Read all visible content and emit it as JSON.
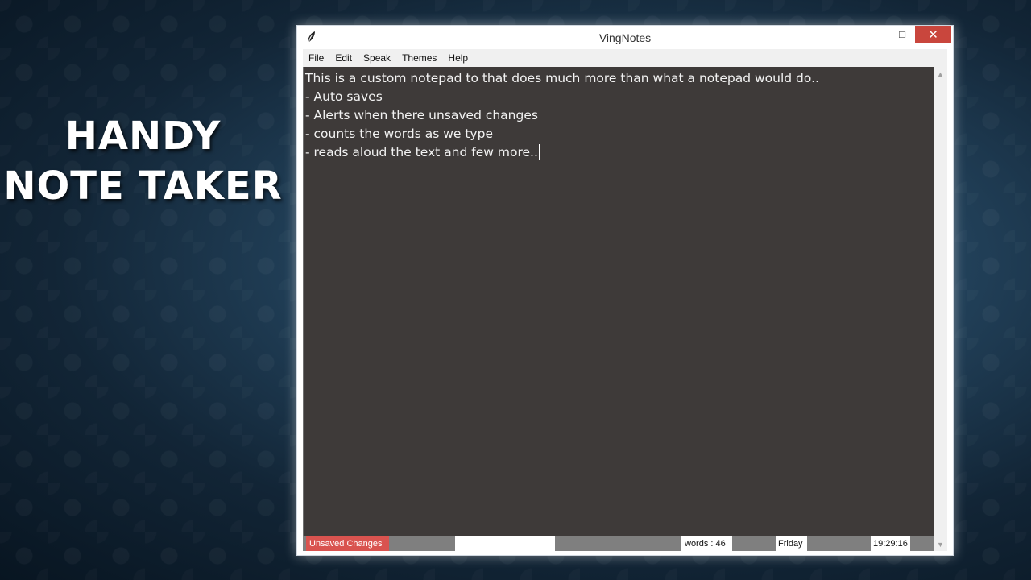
{
  "slide": {
    "title_line1": "HANDY",
    "title_line2": "NOTE TAKER"
  },
  "window": {
    "title": "VingNotes",
    "icon": "feather-icon",
    "controls": {
      "minimize": "—",
      "maximize": "□",
      "close": "✕"
    }
  },
  "menu": {
    "items": [
      "File",
      "Edit",
      "Speak",
      "Themes",
      "Help"
    ]
  },
  "editor": {
    "lines": [
      "This is a custom notepad to that does much more than what a notepad would do..",
      "- Auto saves",
      "- Alerts when there unsaved changes",
      "- counts the words as we type",
      "- reads aloud the text and few more.."
    ]
  },
  "status": {
    "unsaved": "Unsaved Changes",
    "words": "words : 46",
    "day": "Friday",
    "time": "19:29:16"
  },
  "colors": {
    "editor_bg": "#3e3a39",
    "editor_text": "#f2f2f2",
    "unsaved_badge": "#d9534f",
    "close_button": "#c9463d",
    "statusbar_bg": "#7f7f7f"
  }
}
